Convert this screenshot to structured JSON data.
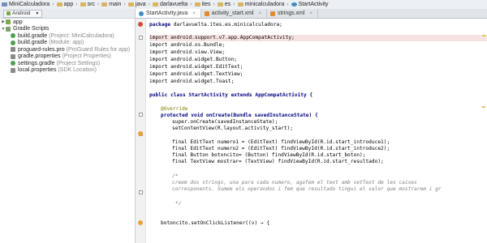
{
  "breadcrumb": [
    "MiniCalculadora",
    "app",
    "src",
    "main",
    "java",
    "darlavuelta",
    "ites",
    "es",
    "minicalculadora",
    "StartActivity"
  ],
  "project_panel": {
    "view_selector": "Android",
    "items": [
      {
        "label": "app",
        "hint": "",
        "icon": "app-module-icon",
        "expanded": false
      },
      {
        "label": "Gradle Scripts",
        "hint": "",
        "icon": "gradle-scripts-icon",
        "expanded": true
      },
      {
        "label": "build.gradle",
        "hint": "(Project: MiniCalculadora)",
        "icon": "gradle-file-icon"
      },
      {
        "label": "build.gradle",
        "hint": "(Module: app)",
        "icon": "gradle-file-icon"
      },
      {
        "label": "proguard-rules.pro",
        "hint": "(ProGuard Rules for app)",
        "icon": "proguard-file-icon"
      },
      {
        "label": "gradle.properties",
        "hint": "(Project Properties)",
        "icon": "properties-file-icon"
      },
      {
        "label": "settings.gradle",
        "hint": "(Project Settings)",
        "icon": "gradle-file-icon"
      },
      {
        "label": "local.properties",
        "hint": "(SDK Location)",
        "icon": "properties-file-icon"
      }
    ]
  },
  "tabs": [
    {
      "label": "StartActivity.java",
      "active": true,
      "icon": "java-class-icon"
    },
    {
      "label": "activity_start.xml",
      "active": false,
      "icon": "xml-file-icon"
    },
    {
      "label": "strings.xml",
      "active": false,
      "icon": "xml-file-icon"
    }
  ],
  "code": {
    "package": "package darlavuelta.ites.es.minicalculadora;",
    "imports": [
      "import android.support.v7.app.AppCompatActivity;",
      "import android.os.Bundle;",
      "import android.view.View;",
      "import android.widget.Button;",
      "import android.widget.EditText;",
      "import android.widget.TextView;",
      "import android.widget.Toast;"
    ],
    "class_decl": "public class StartActivity extends AppCompatActivity {",
    "override": "@Override",
    "oncreate": "protected void onCreate(Bundle savedInstanceState) {",
    "super_call": "super.onCreate(savedInstanceState);",
    "set_content": "setContentView(R.layout.activity_start);",
    "decl1": "final EditText numero1 = (EditText) findViewById(R.id.start_introduce1);",
    "decl2": "final EditText numero2 = (EditText) findViewById(R.id.start_introduce2);",
    "decl3": "final Button botoncito= (Button) findViewById(R.id.start_boton);",
    "decl4": "final TextView mostrar= (TextView) findViewById(R.id.start_resultado);",
    "comment_open": "/*",
    "comment1": "creem dos strings, una para cada numero, agafem el text amb setText de les caixes",
    "comment2": "corresponents. Sumem els operandos i fem que resultado tingui el valor que mostrarem i gr",
    "comment_close": "*/",
    "listener": "botoncito.setOnClickListener((v) → {"
  },
  "colors": {
    "keyword": "#000080",
    "comment": "#808080",
    "annotation": "#808000",
    "field": "#660e7a",
    "error_line": "#f6e3e1"
  }
}
